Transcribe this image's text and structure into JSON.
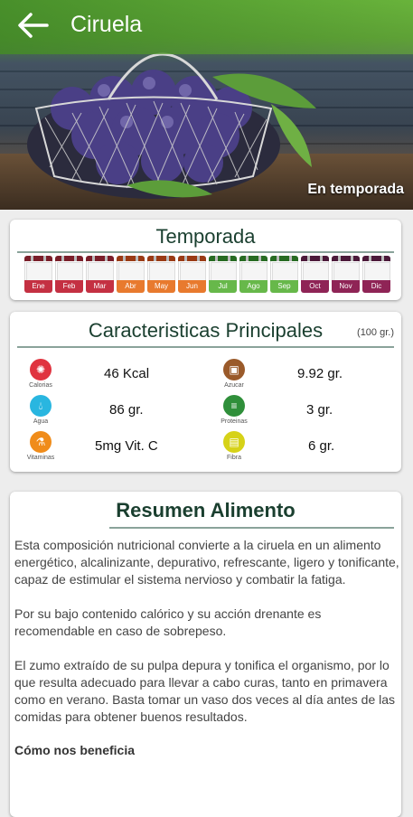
{
  "appbar": {
    "back_icon": "arrow-back",
    "title": "Ciruela"
  },
  "hero": {
    "badge": "En temporada"
  },
  "season": {
    "title": "Temporada",
    "months": [
      {
        "label": "Ene",
        "color": "#c43042"
      },
      {
        "label": "Feb",
        "color": "#c43042"
      },
      {
        "label": "Mar",
        "color": "#c43042"
      },
      {
        "label": "Abr",
        "color": "#e87a2e"
      },
      {
        "label": "May",
        "color": "#e87a2e"
      },
      {
        "label": "Jun",
        "color": "#e87a2e"
      },
      {
        "label": "Jul",
        "color": "#67b84a"
      },
      {
        "label": "Ago",
        "color": "#67b84a"
      },
      {
        "label": "Sep",
        "color": "#67b84a"
      },
      {
        "label": "Oct",
        "color": "#8f2456"
      },
      {
        "label": "Nov",
        "color": "#8f2456"
      },
      {
        "label": "Dic",
        "color": "#8f2456"
      }
    ]
  },
  "features": {
    "title": "Caracteristicas Principales",
    "per": "(100 gr.)",
    "items": [
      {
        "icon": "calories-icon",
        "label": "Calorias",
        "value": "46 Kcal",
        "color": "#e0333f"
      },
      {
        "icon": "sugar-icon",
        "label": "Azucar",
        "value": "9.92 gr.",
        "color": "#9a5a2a"
      },
      {
        "icon": "water-icon",
        "label": "Agua",
        "value": "86 gr.",
        "color": "#29b6e0"
      },
      {
        "icon": "protein-icon",
        "label": "Proteinas",
        "value": "3 gr.",
        "color": "#2f8f3a"
      },
      {
        "icon": "vitamin-icon",
        "label": "Vitaminas",
        "value": "5mg Vit. C",
        "color": "#f08c1a"
      },
      {
        "icon": "fiber-icon",
        "label": "Fibra",
        "value": "6 gr.",
        "color": "#d6d218"
      }
    ]
  },
  "summary": {
    "title": "Resumen Alimento",
    "paragraphs": [
      "Esta composición nutricional convierte a la ciruela en un alimento energético, alcalinizante, depurativo, refrescante, ligero y tonificante, capaz de estimular el sistema nervioso y combatir la fatiga.",
      "Por su bajo contenido calórico y su acción drenante es recomendable en caso de sobrepeso.",
      "El zumo extraído de su pulpa depura y tonifica el organismo, por lo que resulta adecuado para llevar a cabo curas, tanto en primavera como en verano. Basta tomar un vaso dos veces al día antes de las comidas para obtener buenos resultados."
    ],
    "subheading": "Cómo nos beneficia"
  }
}
